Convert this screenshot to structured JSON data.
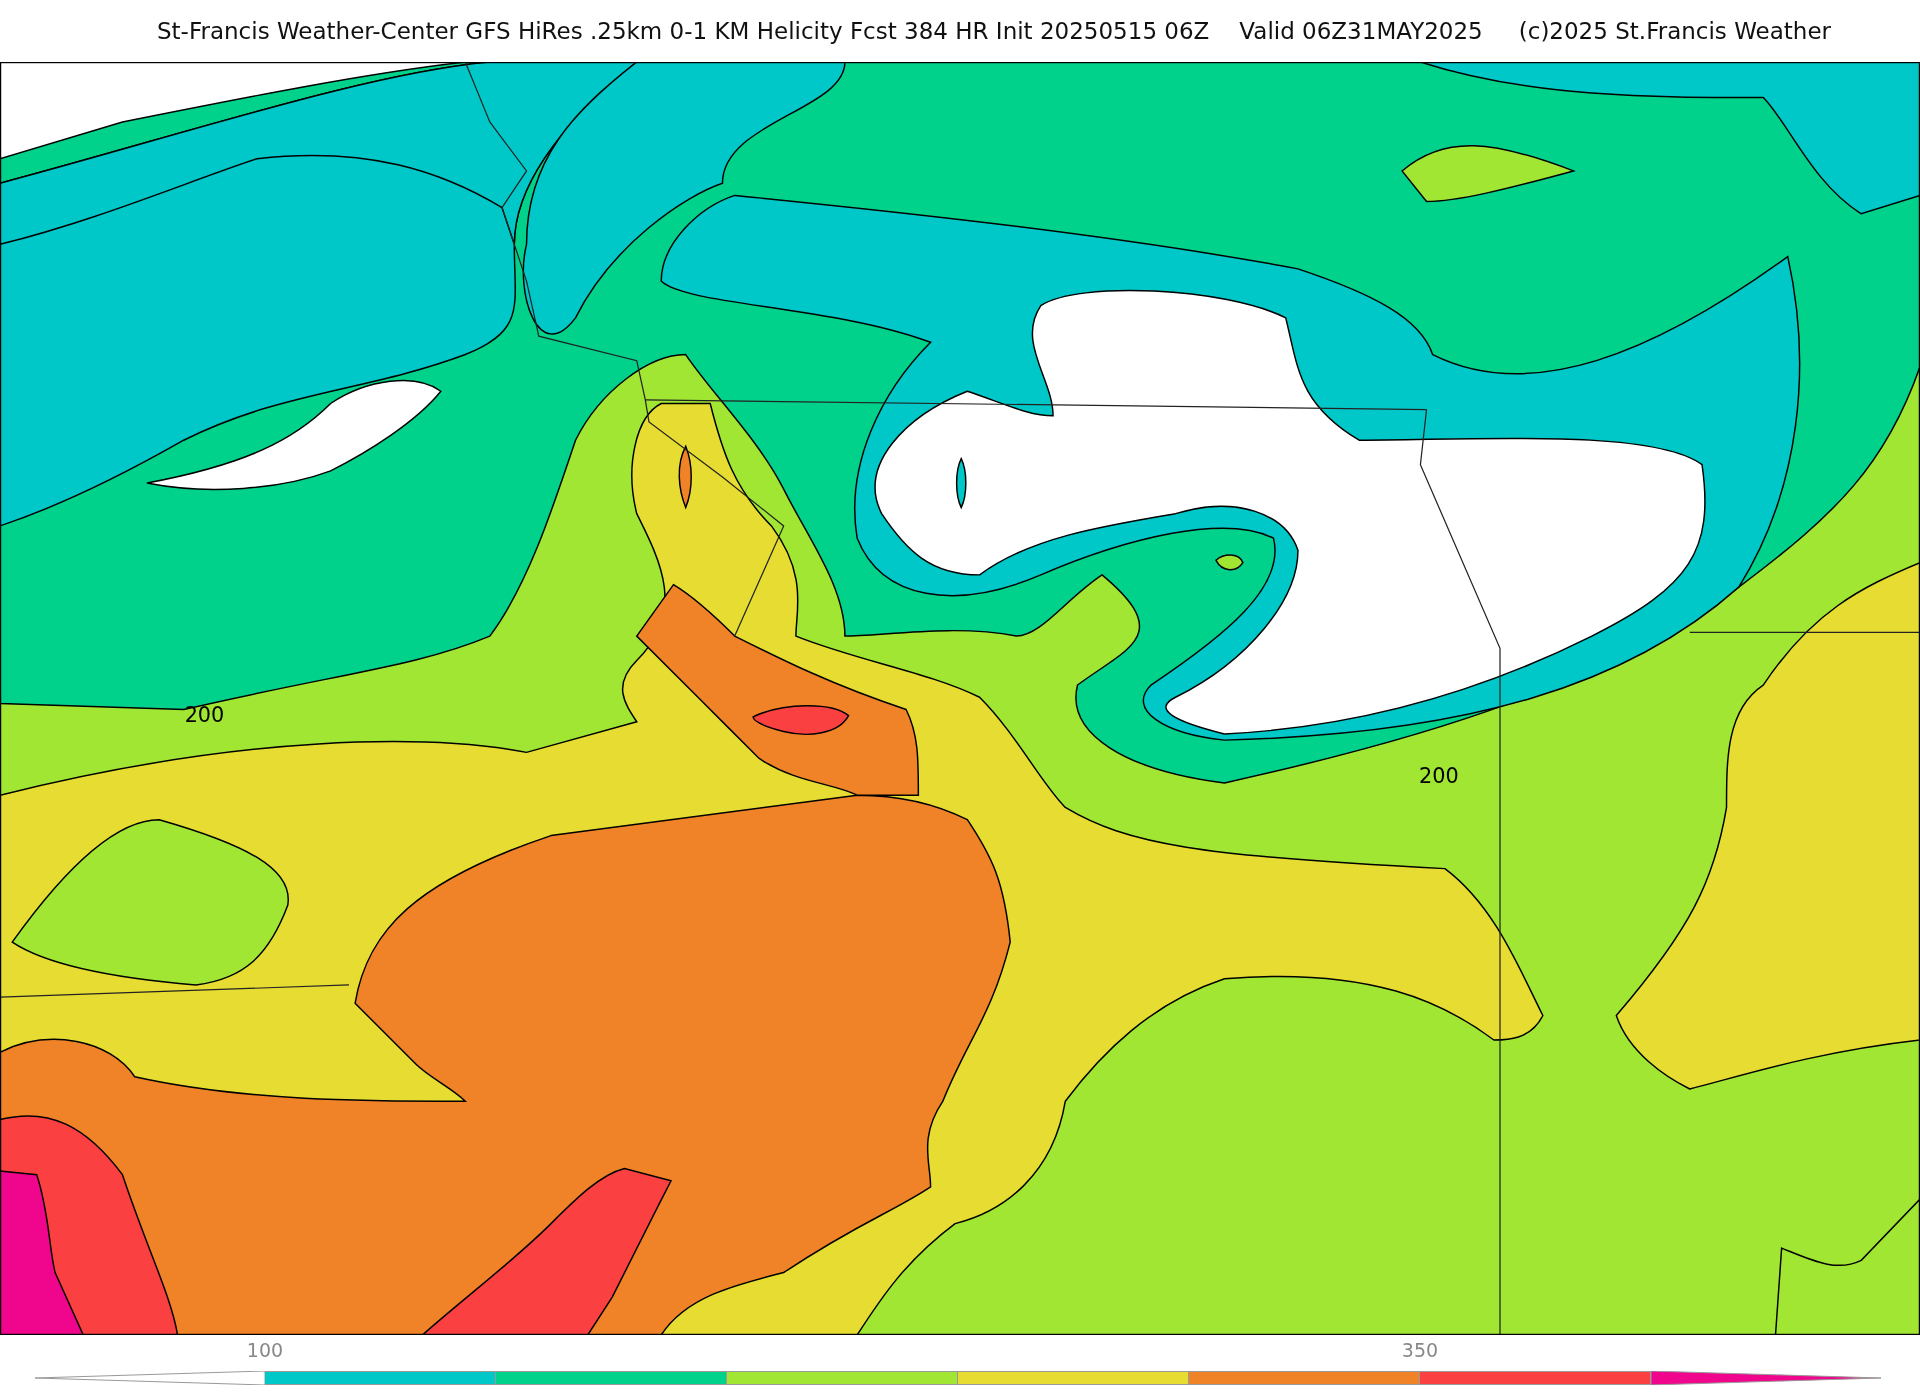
{
  "title": {
    "parts": [
      "St-Francis Weather-Center GFS HiRes .25km 0-1 KM Helicity Fcst 384 HR Init 20250515 06Z",
      "Valid 06Z31MAY2025",
      "(c)2025 St.Francis Weather"
    ]
  },
  "map": {
    "contour_labels": [
      {
        "text": "200"
      },
      {
        "text": "200"
      }
    ]
  },
  "colorbar": {
    "segments": [
      {
        "kind": "triangle-left",
        "color": "#ffffff"
      },
      {
        "kind": "box",
        "color": "#00c8c8",
        "label": "100"
      },
      {
        "kind": "box",
        "color": "#00d28c"
      },
      {
        "kind": "box",
        "color": "#a0e632"
      },
      {
        "kind": "box",
        "color": "#e6dc32"
      },
      {
        "kind": "box",
        "color": "#f08228"
      },
      {
        "kind": "box",
        "color": "#fa4040",
        "label": "350"
      },
      {
        "kind": "triangle-right",
        "color": "#f0068c"
      }
    ]
  }
}
